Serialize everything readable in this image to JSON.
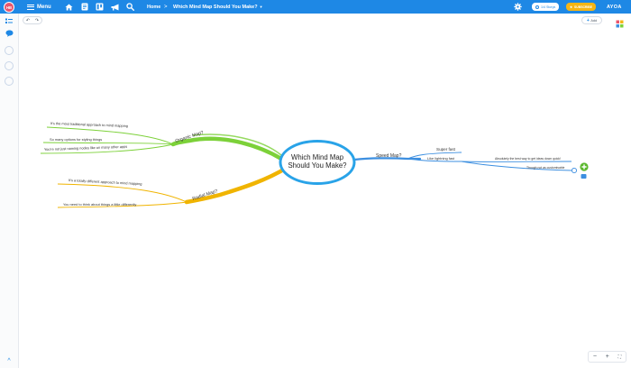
{
  "topbar": {
    "avatar_initials": "HB",
    "menu_label": "Menu",
    "breadcrumb_home": "Home",
    "breadcrumb_separator": ">",
    "map_title": "Which Mind Map Should You Make?",
    "storage_label": "1/4 Storys",
    "subscribe_label": "SUBSCRIBE",
    "brand": "AYOA",
    "icons": [
      "hamburger-icon",
      "home-icon",
      "notes-icon",
      "board-icon",
      "megaphone-icon",
      "search-icon",
      "gear-icon"
    ]
  },
  "toolbar": {
    "undo_icon": "↶",
    "redo_icon": "↷",
    "add_label": "Add"
  },
  "sidebar": {
    "icons": [
      "tasks-icon",
      "chat-icon",
      "user-icon",
      "user-icon",
      "user-icon"
    ],
    "collapse_icon": "^"
  },
  "mindmap": {
    "central": [
      "Which Mind Map",
      "Should You Make?"
    ],
    "branches": [
      {
        "label": "Organic Map?",
        "color": "#7cd139",
        "children": [
          "It's the most traditional approach to mind mapping",
          "So many options for styling things",
          "You're not just naming nodes like on many other apps"
        ]
      },
      {
        "label": "Radial Map?",
        "color": "#f0b400",
        "children": [
          "It's a totally different approach to mind mapping",
          "You need to think about things a little differently"
        ]
      },
      {
        "label": "Speed Map?",
        "color": "#3d8fe0",
        "children": [
          "Super fast",
          "Like lightning fast",
          "Absolutely the best way to get ideas down quick!",
          "Though not as customisable"
        ]
      }
    ]
  },
  "zoom": {
    "out": "−",
    "in": "+",
    "fit": "⛶"
  },
  "colors": {
    "topbar": "#1e88e5",
    "central_border": "#29a3e8",
    "subscribe": "#f6b515",
    "avatar": "#e9556c",
    "add_node": "#5cb82f"
  }
}
